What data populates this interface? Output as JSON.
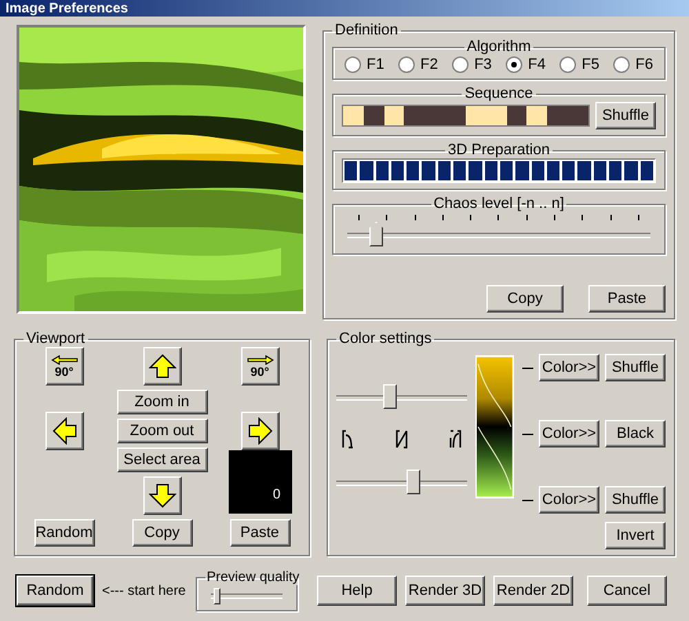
{
  "window": {
    "title": "Image Preferences"
  },
  "definition": {
    "label": "Definition",
    "algorithm": {
      "label": "Algorithm",
      "options": [
        {
          "label": "F1",
          "selected": false
        },
        {
          "label": "F2",
          "selected": false
        },
        {
          "label": "F3",
          "selected": false
        },
        {
          "label": "F4",
          "selected": true
        },
        {
          "label": "F5",
          "selected": false
        },
        {
          "label": "F6",
          "selected": false
        }
      ]
    },
    "sequence": {
      "label": "Sequence",
      "button": "Shuffle",
      "cells": [
        {
          "filled": true
        },
        {
          "filled": false
        },
        {
          "filled": true
        },
        {
          "filled": false
        },
        {
          "filled": false
        },
        {
          "filled": false
        },
        {
          "filled": true
        },
        {
          "filled": true
        },
        {
          "filled": false
        },
        {
          "filled": true
        },
        {
          "filled": false
        },
        {
          "filled": false
        }
      ]
    },
    "preparation": {
      "label": "3D Preparation",
      "level": 1
    },
    "chaos": {
      "label": "Chaos level  [-n .. n]",
      "level": 0.1
    },
    "buttons": [
      "Copy",
      "Paste"
    ]
  },
  "viewport": {
    "label": "Viewport",
    "rotate": [
      "90°",
      "90°"
    ],
    "zoom_buttons": [
      "Zoom in",
      "Zoom out",
      "Select area"
    ],
    "display": "0",
    "buttons": [
      "Random",
      "Copy",
      "Paste"
    ]
  },
  "color_settings": {
    "label": "Color settings",
    "slider_top": {
      "level": 0.42
    },
    "slider_bottom": {
      "level": 0.6
    },
    "rows": [
      {
        "color_button": "Color>>",
        "action": "Shuffle"
      },
      {
        "color_button": "Color>>",
        "action": "Black"
      },
      {
        "color_button": "Color>>",
        "action": "Shuffle"
      }
    ],
    "invert": "Invert"
  },
  "footer": {
    "random": "Random",
    "hint": "<--- start here",
    "quality": {
      "label": "Preview quality",
      "level": 0.08
    },
    "buttons": [
      "Help",
      "Render 3D",
      "Render 2D",
      "Cancel"
    ]
  }
}
